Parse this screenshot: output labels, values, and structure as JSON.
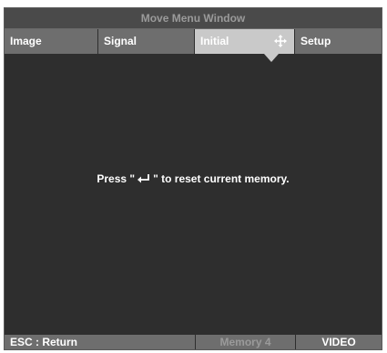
{
  "window": {
    "title": "Move Menu Window"
  },
  "tabs": [
    {
      "label": "Image"
    },
    {
      "label": "Signal"
    },
    {
      "label": "Initial",
      "active": true,
      "icon": "move-icon"
    },
    {
      "label": "Setup"
    }
  ],
  "main": {
    "message_before": "Press \"",
    "enter_icon": "enter-return-icon",
    "message_after": "\" to reset current memory."
  },
  "status": {
    "esc_label": "ESC : Return",
    "memory_label": "Memory 4",
    "source_label": "VIDEO"
  },
  "colors": {
    "background": "#2e2e2e",
    "tab_inactive": "#6e6e6e",
    "tab_active": "#c9c9c9",
    "title_text": "#9a9a9a"
  }
}
